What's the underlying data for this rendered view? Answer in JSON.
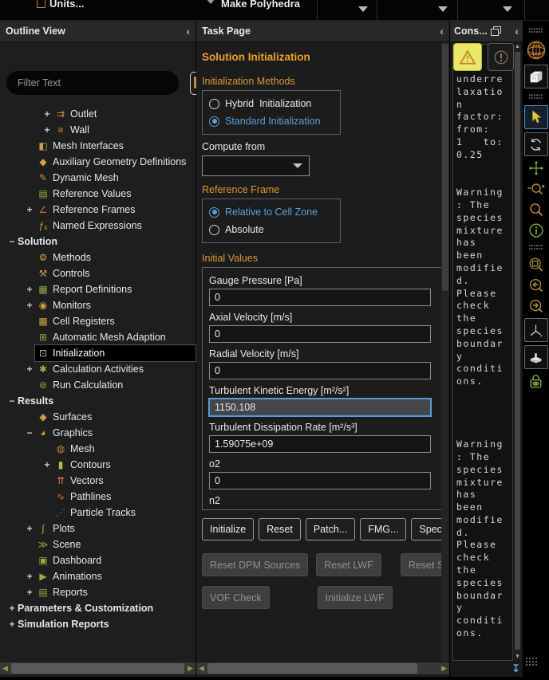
{
  "topbar": {
    "units_label": "Units...",
    "make_polyhedra_label": "Make Polyhedra",
    "dropdown_count": 3
  },
  "outline": {
    "title": "Outline View",
    "filter_placeholder": "Filter Text",
    "items": [
      {
        "label": "Outlet",
        "level": 2,
        "expander": "+",
        "icon": "outlet-icon"
      },
      {
        "label": "Wall",
        "level": 2,
        "expander": "+",
        "icon": "wall-icon"
      },
      {
        "label": "Mesh Interfaces",
        "level": 1,
        "expander": "",
        "icon": "mesh-interfaces-icon"
      },
      {
        "label": "Auxiliary Geometry Definitions",
        "level": 1,
        "expander": "",
        "icon": "auxiliary-geometry-icon"
      },
      {
        "label": "Dynamic Mesh",
        "level": 1,
        "expander": "",
        "icon": "dynamic-mesh-icon"
      },
      {
        "label": "Reference Values",
        "level": 1,
        "expander": "",
        "icon": "reference-values-icon"
      },
      {
        "label": "Reference Frames",
        "level": 1,
        "expander": "+",
        "icon": "reference-frames-icon"
      },
      {
        "label": "Named Expressions",
        "level": 1,
        "expander": "",
        "icon": "named-expressions-icon"
      },
      {
        "label": "Solution",
        "level": 0,
        "expander": "−",
        "icon": "",
        "bold": true
      },
      {
        "label": "Methods",
        "level": 1,
        "expander": "",
        "icon": "methods-icon"
      },
      {
        "label": "Controls",
        "level": 1,
        "expander": "",
        "icon": "controls-icon"
      },
      {
        "label": "Report Definitions",
        "level": 1,
        "expander": "+",
        "icon": "report-definitions-icon"
      },
      {
        "label": "Monitors",
        "level": 1,
        "expander": "+",
        "icon": "monitors-icon"
      },
      {
        "label": "Cell Registers",
        "level": 1,
        "expander": "",
        "icon": "cell-registers-icon"
      },
      {
        "label": "Automatic Mesh Adaption",
        "level": 1,
        "expander": "",
        "icon": "automatic-mesh-adaption-icon"
      },
      {
        "label": "Initialization",
        "level": 1,
        "expander": "",
        "icon": "initialization-icon",
        "selected": true
      },
      {
        "label": "Calculation Activities",
        "level": 1,
        "expander": "+",
        "icon": "calculation-activities-icon"
      },
      {
        "label": "Run Calculation",
        "level": 1,
        "expander": "",
        "icon": "run-calculation-icon"
      },
      {
        "label": "Results",
        "level": 0,
        "expander": "−",
        "icon": "",
        "bold": true
      },
      {
        "label": "Surfaces",
        "level": 1,
        "expander": "",
        "icon": "surfaces-icon"
      },
      {
        "label": "Graphics",
        "level": 1,
        "expander": "−",
        "icon": "graphics-icon"
      },
      {
        "label": "Mesh",
        "level": 2,
        "expander": "",
        "icon": "mesh-icon"
      },
      {
        "label": "Contours",
        "level": 2,
        "expander": "+",
        "icon": "contours-icon"
      },
      {
        "label": "Vectors",
        "level": 2,
        "expander": "",
        "icon": "vectors-icon"
      },
      {
        "label": "Pathlines",
        "level": 2,
        "expander": "",
        "icon": "pathlines-icon"
      },
      {
        "label": "Particle Tracks",
        "level": 2,
        "expander": "",
        "icon": "particle-tracks-icon"
      },
      {
        "label": "Plots",
        "level": 1,
        "expander": "+",
        "icon": "plots-icon"
      },
      {
        "label": "Scene",
        "level": 1,
        "expander": "",
        "icon": "scene-icon"
      },
      {
        "label": "Dashboard",
        "level": 1,
        "expander": "",
        "icon": "dashboard-icon"
      },
      {
        "label": "Animations",
        "level": 1,
        "expander": "+",
        "icon": "animations-icon"
      },
      {
        "label": "Reports",
        "level": 1,
        "expander": "+",
        "icon": "reports-icon"
      },
      {
        "label": "Parameters & Customization",
        "level": 0,
        "expander": "+",
        "icon": "",
        "bold": true
      },
      {
        "label": "Simulation Reports",
        "level": 0,
        "expander": "+",
        "icon": "",
        "bold": true
      }
    ]
  },
  "taskpage": {
    "title": "Task Page",
    "heading": "Solution Initialization",
    "init_methods": {
      "label": "Initialization Methods",
      "options": [
        {
          "label": "Hybrid  Initialization",
          "selected": false
        },
        {
          "label": "Standard Initialization",
          "selected": true
        }
      ]
    },
    "compute_from_label": "Compute from",
    "compute_from_value": "",
    "reference_frame": {
      "label": "Reference Frame",
      "options": [
        {
          "label": "Relative to Cell Zone",
          "selected": true
        },
        {
          "label": "Absolute",
          "selected": false
        }
      ]
    },
    "initial_values": {
      "label": "Initial Values",
      "fields": [
        {
          "label": "Gauge Pressure [Pa]",
          "value": "0"
        },
        {
          "label": "Axial Velocity [m/s]",
          "value": "0"
        },
        {
          "label": "Radial Velocity [m/s]",
          "value": "0"
        },
        {
          "label": "Turbulent Kinetic Energy [m²/s²]",
          "value": "1150.108",
          "focused": true
        },
        {
          "label": "Turbulent Dissipation Rate [m²/s³]",
          "value": "1.59075e+09"
        },
        {
          "label": "o2",
          "value": "0"
        },
        {
          "label": "n2",
          "value": "",
          "label_only": true
        }
      ]
    },
    "buttons": {
      "primary": [
        "Initialize",
        "Reset",
        "Patch...",
        "FMG...",
        "Species"
      ],
      "disabled_row1": [
        "Reset DPM Sources",
        "Reset LWF",
        "Reset Statistics"
      ],
      "disabled_row2": [
        "VOF Check",
        "Initialize LWF"
      ]
    }
  },
  "console": {
    "title": "Cons...",
    "buttons": [
      {
        "name": "warnings-toggle",
        "icon": "warning-triangle-icon",
        "active": true
      },
      {
        "name": "errors-toggle",
        "icon": "error-circle-icon",
        "active": false
      }
    ],
    "lines": [
      "underre",
      "laxatio",
      "n",
      "factor:",
      "from:",
      "1   to:",
      "0.25",
      "",
      "",
      "Warning",
      ": The",
      "species",
      "mixture",
      "has",
      "been",
      "modifie",
      "d.",
      "Please",
      "check",
      "the",
      "species",
      "boundar",
      "y",
      "conditi",
      "ons.",
      "",
      "",
      "",
      "",
      "Warning",
      ": The",
      "species",
      "mixture",
      "has",
      "been",
      "modifie",
      "d.",
      "Please",
      "check",
      "the",
      "species",
      "boundar",
      "y",
      "conditi",
      "ons."
    ]
  },
  "right_toolbar": {
    "items": [
      {
        "name": "grip-handle",
        "type": "grip"
      },
      {
        "name": "mesh-display-icon",
        "type": "icon"
      },
      {
        "name": "solid-cube-icon",
        "type": "boxed"
      },
      {
        "name": "grip-handle",
        "type": "grip"
      },
      {
        "name": "select-pointer-icon",
        "type": "boxed-active"
      },
      {
        "name": "rotate-view-icon",
        "type": "boxed"
      },
      {
        "name": "pan-view-icon",
        "type": "icon"
      },
      {
        "name": "zoom-in-out-icon",
        "type": "icon"
      },
      {
        "name": "examine-icon",
        "type": "icon"
      },
      {
        "name": "probe-info-icon",
        "type": "icon"
      },
      {
        "name": "grip-handle",
        "type": "grip"
      },
      {
        "name": "zoom-to-area-icon",
        "type": "icon"
      },
      {
        "name": "previous-view-icon",
        "type": "icon"
      },
      {
        "name": "next-view-icon",
        "type": "icon"
      },
      {
        "name": "axis-triad-icon",
        "type": "boxed"
      },
      {
        "name": "clip-plane-icon",
        "type": "boxed"
      },
      {
        "name": "lock-view-icon",
        "type": "icon"
      }
    ]
  },
  "colors": {
    "heading_orange": "#f0a32a",
    "label_orange": "#d89a33",
    "selected_blue": "#5aa0d8",
    "warning_yellow": "#e9e867",
    "icon_orange": "#c8822f",
    "icon_green": "#7da343",
    "console_text": "#d8d8d8"
  }
}
